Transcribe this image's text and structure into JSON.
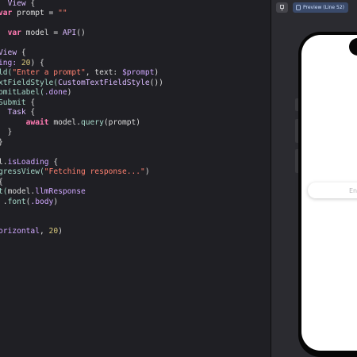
{
  "editor": {
    "lines": [
      [
        {
          "t": "  ",
          "k": "plain"
        },
        {
          "t": "View",
          "k": "type"
        },
        {
          "t": " {",
          "k": "plain"
        }
      ],
      [
        {
          "t": "var",
          "k": "kw"
        },
        {
          "t": " prompt = ",
          "k": "plain"
        },
        {
          "t": "\"\"",
          "k": "str"
        }
      ],
      [],
      [
        {
          "t": "  ",
          "k": "plain"
        },
        {
          "t": "var",
          "k": "kw"
        },
        {
          "t": " model = ",
          "k": "plain"
        },
        {
          "t": "API",
          "k": "type"
        },
        {
          "t": "()",
          "k": "plain"
        }
      ],
      [],
      [
        {
          "t": "View",
          "k": "type"
        },
        {
          "t": " {",
          "k": "plain"
        }
      ],
      [
        {
          "t": "ing: ",
          "k": "prop"
        },
        {
          "t": "20",
          "k": "num"
        },
        {
          "t": ") {",
          "k": "plain"
        }
      ],
      [
        {
          "t": "ld(",
          "k": "fn"
        },
        {
          "t": "\"Enter a prompt\"",
          "k": "str"
        },
        {
          "t": ", text: ",
          "k": "plain"
        },
        {
          "t": "$prompt",
          "k": "prop"
        },
        {
          "t": ")",
          "k": "plain"
        }
      ],
      [
        {
          "t": "xtFieldStyle(",
          "k": "fn"
        },
        {
          "t": "CustomTextFieldStyle",
          "k": "type"
        },
        {
          "t": "())",
          "k": "plain"
        }
      ],
      [
        {
          "t": "bmitLabel(",
          "k": "fn"
        },
        {
          "t": ".done",
          "k": "prop"
        },
        {
          "t": ")",
          "k": "plain"
        }
      ],
      [
        {
          "t": "Submit",
          "k": "fn"
        },
        {
          "t": " {",
          "k": "plain"
        }
      ],
      [
        {
          "t": "  Task",
          "k": "type"
        },
        {
          "t": " {",
          "k": "plain"
        }
      ],
      [
        {
          "t": "      ",
          "k": "plain"
        },
        {
          "t": "await",
          "k": "kw"
        },
        {
          "t": " model.",
          "k": "plain"
        },
        {
          "t": "query",
          "k": "fn"
        },
        {
          "t": "(prompt)",
          "k": "plain"
        }
      ],
      [
        {
          "t": "  }",
          "k": "plain"
        }
      ],
      [
        {
          "t": "}",
          "k": "plain"
        }
      ],
      [],
      [
        {
          "t": "l.",
          "k": "plain"
        },
        {
          "t": "isLoading",
          "k": "prop"
        },
        {
          "t": " {",
          "k": "plain"
        }
      ],
      [
        {
          "t": "gressView(",
          "k": "fn"
        },
        {
          "t": "\"Fetching response...\"",
          "k": "str"
        },
        {
          "t": ")",
          "k": "plain"
        }
      ],
      [
        {
          "t": "{",
          "k": "plain"
        }
      ],
      [
        {
          "t": "t(",
          "k": "fn"
        },
        {
          "t": "model.",
          "k": "plain"
        },
        {
          "t": "llmResponse",
          "k": "prop"
        }
      ],
      [
        {
          "t": " .",
          "k": "plain"
        },
        {
          "t": "font",
          "k": "fn"
        },
        {
          "t": "(",
          "k": "plain"
        },
        {
          "t": ".body",
          "k": "prop"
        },
        {
          "t": ")",
          "k": "plain"
        }
      ],
      [],
      [],
      [
        {
          "t": "orizontal",
          "k": "prop"
        },
        {
          "t": ", ",
          "k": "plain"
        },
        {
          "t": "20",
          "k": "num"
        },
        {
          "t": ")",
          "k": "plain"
        }
      ]
    ]
  },
  "preview": {
    "toolbar_icon": "preview-pin-icon",
    "chip_label": "Preview (Line 52)",
    "text_field_placeholder": "Enter a prompt"
  },
  "colors": {
    "editor_bg": "#1f1f24",
    "preview_bg": "#2b2b30",
    "keyword": "#ff7ab2",
    "string": "#ff8170",
    "type": "#dabaff",
    "function": "#a6d8c9",
    "number": "#d9c97c"
  }
}
